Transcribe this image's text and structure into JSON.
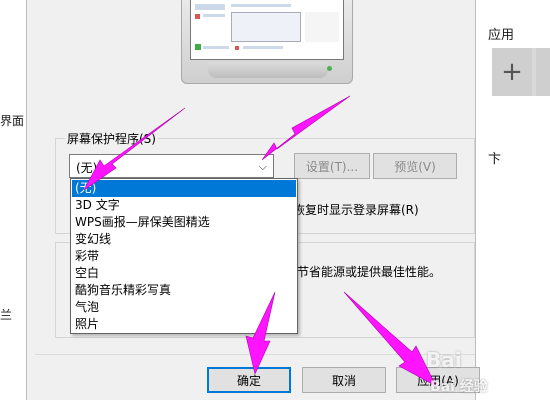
{
  "background": {
    "left_fragments": [
      "界面",
      "兰"
    ],
    "right_title": "应用",
    "right_plus": "+",
    "right_fragment": "卞"
  },
  "dialog": {
    "screensaver_group_label": "屏幕保护程序(S)",
    "combo_value": "(无)",
    "combo_arrow": "⌵",
    "settings_button": "设置(T)...",
    "preview_button": "预览(V)",
    "resume_text": "恢复时显示登录屏幕(R)",
    "power_text": "节省能源或提供最佳性能。",
    "dropdown_items": [
      "(无)",
      "3D 文字",
      "WPS画报—屏保美图精选",
      "变幻线",
      "彩带",
      "空白",
      "酷狗音乐精彩写真",
      "气泡",
      "照片"
    ],
    "selected_index": 0,
    "ok_button": "确定",
    "cancel_button": "取消",
    "apply_button": "应用(A)"
  },
  "watermark": {
    "text": "Bai 经验",
    "logo": "Bai"
  },
  "colors": {
    "arrow": "#ff14ff",
    "selection": "#0078d7",
    "dialog_bg": "#f0f0f0"
  }
}
